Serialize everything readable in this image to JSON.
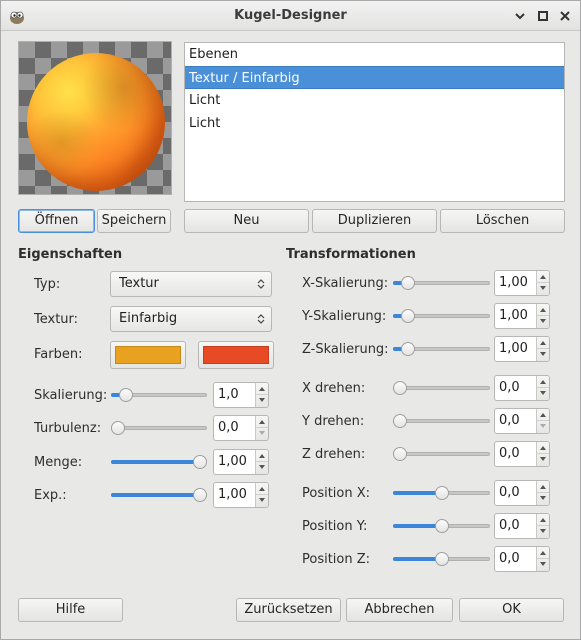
{
  "window": {
    "title": "Kugel-Designer",
    "controls": [
      "minimize-icon",
      "maximize-icon",
      "close-icon"
    ]
  },
  "layers": {
    "items": [
      "Ebenen",
      "Textur / Einfarbig",
      "Licht",
      "Licht"
    ],
    "selected_index": 1
  },
  "preview_buttons": {
    "open": "Öffnen",
    "save": "Speichern"
  },
  "layer_buttons": {
    "new": "Neu",
    "duplicate": "Duplizieren",
    "delete": "Löschen"
  },
  "properties": {
    "heading": "Eigenschaften",
    "type_label": "Typ:",
    "type_value": "Textur",
    "texture_label": "Textur:",
    "texture_value": "Einfarbig",
    "colors_label": "Farben:",
    "color1": "#e8a21f",
    "color2": "#e84a25",
    "sliders": [
      {
        "label": "Skalierung:",
        "value": "1,0",
        "level": 0.1,
        "down_dim": false
      },
      {
        "label": "Turbulenz:",
        "value": "0,0",
        "level": 0.0,
        "down_dim": true
      },
      {
        "label": "Menge:",
        "value": "1,00",
        "level": 1.0,
        "down_dim": false
      },
      {
        "label": "Exp.:",
        "value": "1,00",
        "level": 1.0,
        "down_dim": false
      }
    ]
  },
  "transformations": {
    "heading": "Transformationen",
    "sliders": [
      {
        "label": "X-Skalierung:",
        "value": "1,00",
        "level": 0.1,
        "down_dim": false
      },
      {
        "label": "Y-Skalierung:",
        "value": "1,00",
        "level": 0.1,
        "down_dim": false
      },
      {
        "label": "Z-Skalierung:",
        "value": "1,00",
        "level": 0.1,
        "down_dim": false
      },
      {
        "label": "X drehen:",
        "value": "0,0",
        "level": 0.0,
        "down_dim": false
      },
      {
        "label": "Y drehen:",
        "value": "0,0",
        "level": 0.0,
        "down_dim": true
      },
      {
        "label": "Z drehen:",
        "value": "0,0",
        "level": 0.0,
        "down_dim": false
      },
      {
        "label": "Position X:",
        "value": "0,0",
        "level": 0.5,
        "down_dim": false
      },
      {
        "label": "Position Y:",
        "value": "0,0",
        "level": 0.5,
        "down_dim": false
      },
      {
        "label": "Position Z:",
        "value": "0,0",
        "level": 0.5,
        "down_dim": false
      }
    ]
  },
  "footer": {
    "help": "Hilfe",
    "reset": "Zurücksetzen",
    "cancel": "Abbrechen",
    "ok": "OK"
  }
}
